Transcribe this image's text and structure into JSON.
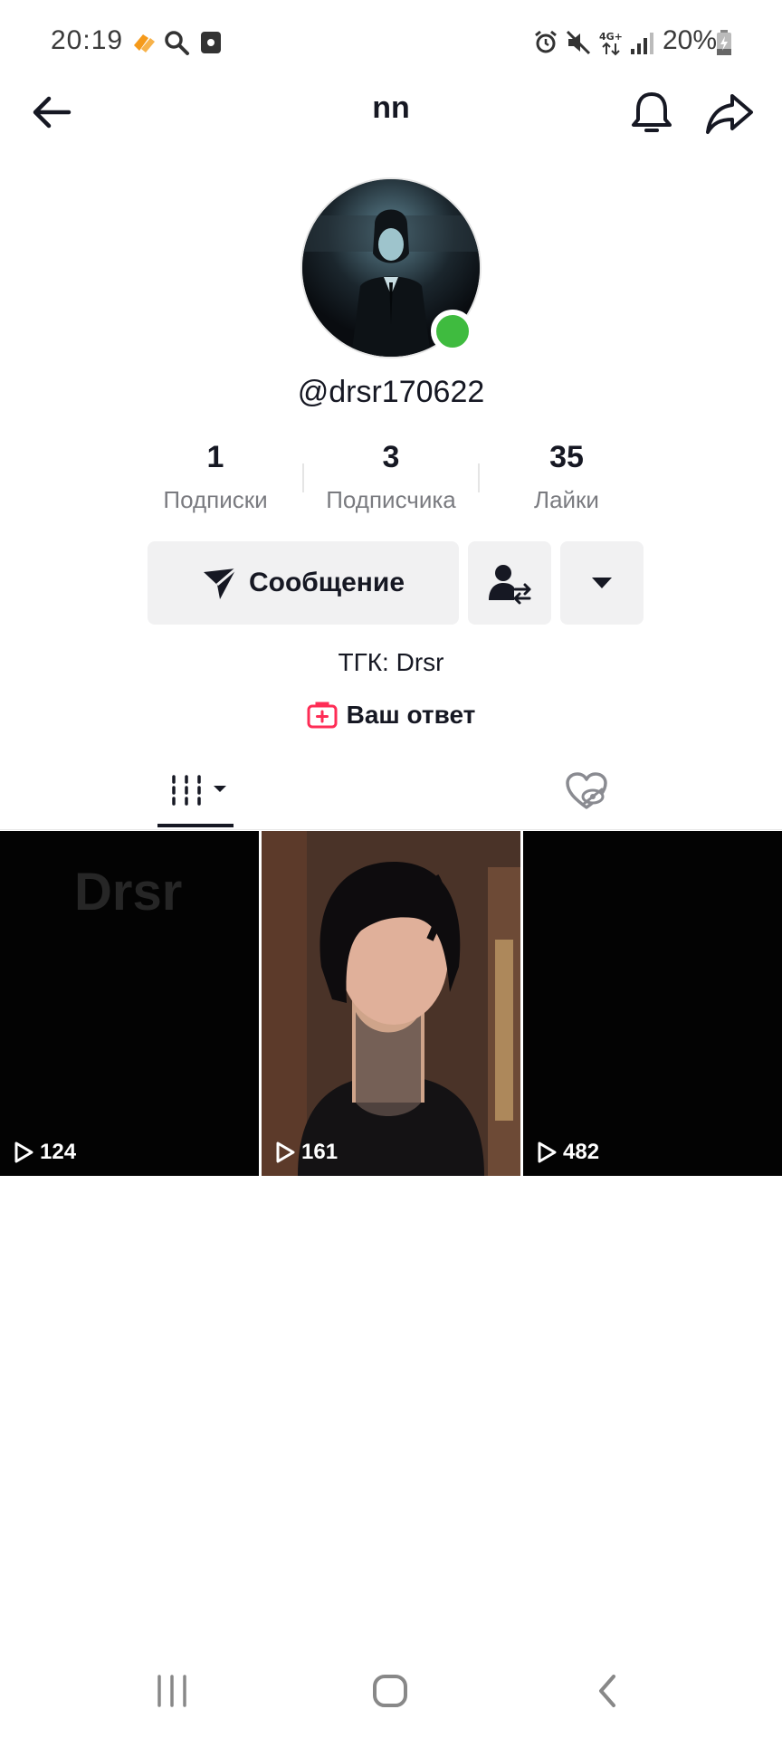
{
  "status_bar": {
    "time": "20:19",
    "battery": "20%",
    "icons": [
      "orange-app-icon",
      "search-icon",
      "screen-record-icon",
      "alarm-icon",
      "mute-icon",
      "4g-data-icon",
      "signal-icon",
      "battery-icon"
    ]
  },
  "header": {
    "title": "nn",
    "back_icon": "arrow-left-icon",
    "bell_icon": "bell-icon",
    "share_icon": "share-icon"
  },
  "profile": {
    "username": "@drsr170622",
    "online": true,
    "online_color": "#3fbb3f",
    "stats": [
      {
        "value": "1",
        "label": "Подписки"
      },
      {
        "value": "3",
        "label": "Подписчика"
      },
      {
        "value": "35",
        "label": "Лайки"
      }
    ],
    "message_button": "Сообщение",
    "bio": "ТГК: Drsr",
    "reply_label": "Ваш ответ",
    "reply_color": "#fe2c55"
  },
  "tabs": {
    "videos_icon": "grid-videos-icon",
    "liked_icon": "hidden-liked-icon"
  },
  "videos": [
    {
      "views": "124",
      "overlay_text": "Drsr"
    },
    {
      "views": "161",
      "overlay_text": ""
    },
    {
      "views": "482",
      "overlay_text": ""
    }
  ],
  "nav": {
    "recent": "recent-apps-icon",
    "home": "home-icon",
    "back": "back-icon"
  }
}
